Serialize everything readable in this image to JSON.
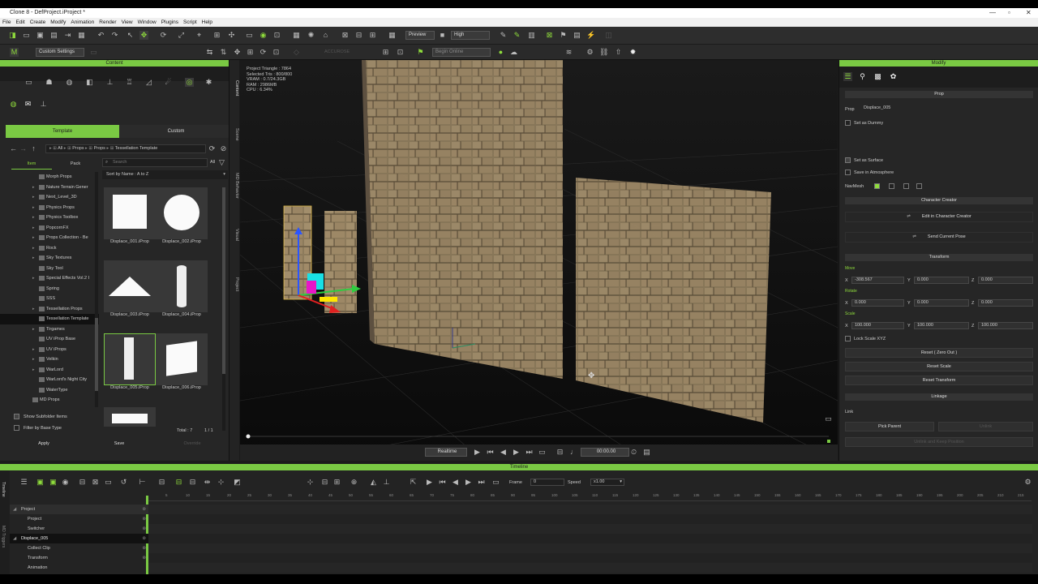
{
  "window": {
    "title": "Clone 8 - DefProject.iProject *"
  },
  "menu": [
    "File",
    "Edit",
    "Create",
    "Modify",
    "Animation",
    "Render",
    "View",
    "Window",
    "Plugins",
    "Script",
    "Help"
  ],
  "toolbar": {
    "preview_label": "Preview",
    "quality_label": "High",
    "custom_settings": "Custom Settings",
    "accurate_label": "ACCUROSE",
    "search_placeholder": "Begin Online"
  },
  "content": {
    "header": "Content",
    "tabs": [
      "Template",
      "Custom"
    ],
    "breadcrumb": [
      "All",
      "Props",
      "Props",
      "Tessellation Template"
    ],
    "subtabs": [
      "Item",
      "Pack"
    ],
    "search_placeholder": "Search",
    "search_filter": "All",
    "sort": "Sort by Name : A to Z",
    "tree": [
      "Morph Props",
      "Nature Terrain Gener",
      "Next_Level_3D",
      "Physics Props",
      "Physics Toolbox",
      "PopcornFX",
      "Props Collection - Be",
      "Rock",
      "Sky Textures",
      "Sky Tool",
      "Special Effects Vol.2 I",
      "Spring",
      "SSS",
      "Tessellation Props",
      "Tessellation Template",
      "Tirgames",
      "UV iProp Base",
      "UV iProps",
      "Velkin",
      "WarLord",
      "WarLord's Night City",
      "WaterType",
      "MD Props"
    ],
    "thumbs": [
      "Displace_001.iProp",
      "Displace_002.iProp",
      "Displace_003.iProp",
      "Displace_004.iProp",
      "Displace_005.iProp",
      "Displace_006.iProp"
    ],
    "total": "Total : 7",
    "paging": "1 / 1",
    "show_subfolder": "Show Subfolder Items",
    "filter_base": "Filter by Base Type",
    "apply": "Apply",
    "save": "Save",
    "override": "Override"
  },
  "side_tabs": [
    "Content",
    "Scene",
    "MD Behavior",
    "Visual",
    "Project"
  ],
  "viewport": {
    "stats": [
      "Project Triangle : 7864",
      "Selected Tris : 800/800",
      "VRAM : 0.7/24.3GB",
      "RAM : 2986MB",
      "CPU : 6.34%"
    ],
    "play_mode": "Realtime",
    "time": "00:00.00"
  },
  "modify": {
    "header": "Modify",
    "prop_header": "Prop",
    "prop_label": "Prop",
    "prop_name": "Displace_005",
    "set_dummy": "Set as Dummy",
    "set_surface": "Set as Surface",
    "save_atmosphere": "Save in Atmosphere",
    "navmesh": "NavMesh",
    "char_creator": "Character Creator",
    "edit_cc": "Edit in Character Creator",
    "send_pose": "Send Current Pose",
    "transform": "Transform",
    "move": "Move",
    "rotate": "Rotate",
    "scale": "Scale",
    "move_vals": [
      "-308.567",
      "0.000",
      "0.000"
    ],
    "rot_vals": [
      "0.000",
      "0.000",
      "0.000"
    ],
    "scale_vals": [
      "100.000",
      "100.000",
      "100.000"
    ],
    "lock_scale": "Lock Scale XYZ",
    "reset_zero": "Reset ( Zero Out )",
    "reset_scale": "Reset Scale",
    "reset_transform": "Reset Transform",
    "linkage": "Linkage",
    "link": "Link",
    "pick_parent": "Pick Parent",
    "unlink": "Unlink",
    "unlink_keep": "Unlink and Keep Position"
  },
  "timeline": {
    "header": "Timeline",
    "frame_label": "Frame",
    "frame_val": "0",
    "speed_label": "Speed",
    "speed_val": "x1.00",
    "ruler": [
      "5",
      "10",
      "15",
      "20",
      "25",
      "30",
      "35",
      "40",
      "45",
      "50",
      "55",
      "60",
      "65",
      "70",
      "75",
      "80",
      "85",
      "90",
      "95",
      "100",
      "105",
      "110",
      "115",
      "120",
      "125",
      "130",
      "135",
      "140",
      "145",
      "150",
      "155",
      "160",
      "165",
      "170",
      "175",
      "180",
      "185",
      "190",
      "195",
      "200",
      "205",
      "210",
      "215"
    ],
    "tracks": [
      "Project",
      "Project",
      "Switcher",
      "Displace_005",
      "Collect Clip",
      "Transform",
      "Animation"
    ],
    "side": [
      "Timeline",
      "MD Triggers"
    ]
  },
  "colors": {
    "accent": "#7ac943"
  }
}
